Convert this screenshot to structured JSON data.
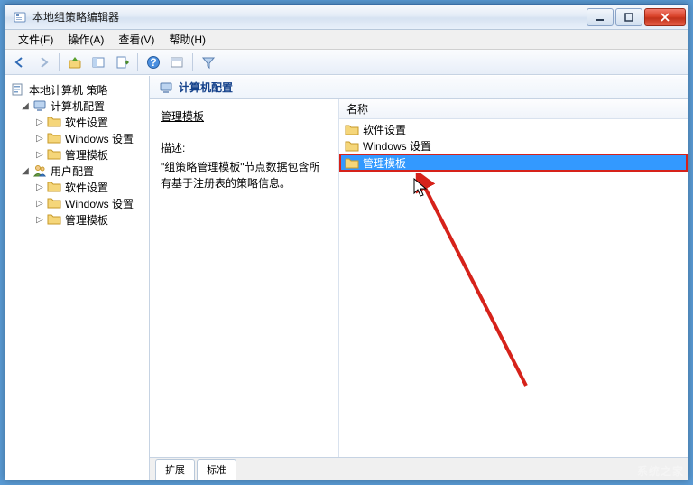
{
  "window": {
    "title": "本地组策略编辑器"
  },
  "menu": {
    "file": "文件(F)",
    "action": "操作(A)",
    "view": "查看(V)",
    "help": "帮助(H)"
  },
  "tree": {
    "root": "本地计算机 策略",
    "computer": "计算机配置",
    "user": "用户配置",
    "software": "软件设置",
    "windows": "Windows 设置",
    "admin": "管理模板"
  },
  "content": {
    "header": "计算机配置",
    "section_title": "管理模板",
    "desc_label": "描述:",
    "desc_body": "\"组策略管理模板\"节点数据包含所有基于注册表的策略信息。",
    "list_header": "名称",
    "items": {
      "software": "软件设置",
      "windows": "Windows 设置",
      "admin": "管理模板"
    }
  },
  "tabs": {
    "extended": "扩展",
    "standard": "标准"
  },
  "watermark": "系统之家"
}
